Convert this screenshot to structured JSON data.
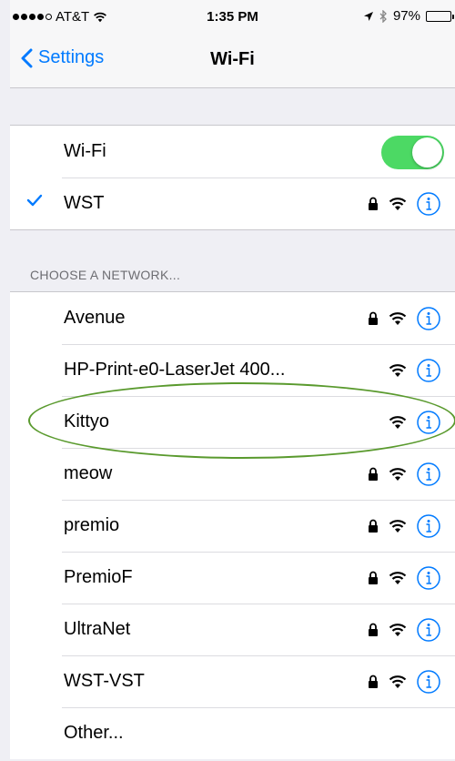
{
  "status_bar": {
    "carrier": "AT&T",
    "time": "1:35 PM",
    "battery": "97%",
    "battery_level": 0.97,
    "icons": [
      "signal-dots-icon",
      "wifi-icon",
      "location-arrow-icon",
      "bluetooth-icon",
      "battery-icon"
    ]
  },
  "nav": {
    "back_label": "Settings",
    "title": "Wi-Fi"
  },
  "wifi_toggle": {
    "label": "Wi-Fi",
    "on": true
  },
  "connected": {
    "name": "WST",
    "locked": true
  },
  "section_header": "CHOOSE A NETWORK...",
  "networks": [
    {
      "name": "Avenue",
      "locked": true
    },
    {
      "name": "HP-Print-e0-LaserJet 400...",
      "locked": false
    },
    {
      "name": "Kittyo",
      "locked": false
    },
    {
      "name": "meow",
      "locked": true
    },
    {
      "name": "premio",
      "locked": true
    },
    {
      "name": "PremioF",
      "locked": true
    },
    {
      "name": "UltraNet",
      "locked": true
    },
    {
      "name": "WST-VST",
      "locked": true
    }
  ],
  "other_label": "Other...",
  "colors": {
    "accent": "#007aff",
    "toggle_on": "#4cd964",
    "annotation": "#5a9a2e"
  }
}
